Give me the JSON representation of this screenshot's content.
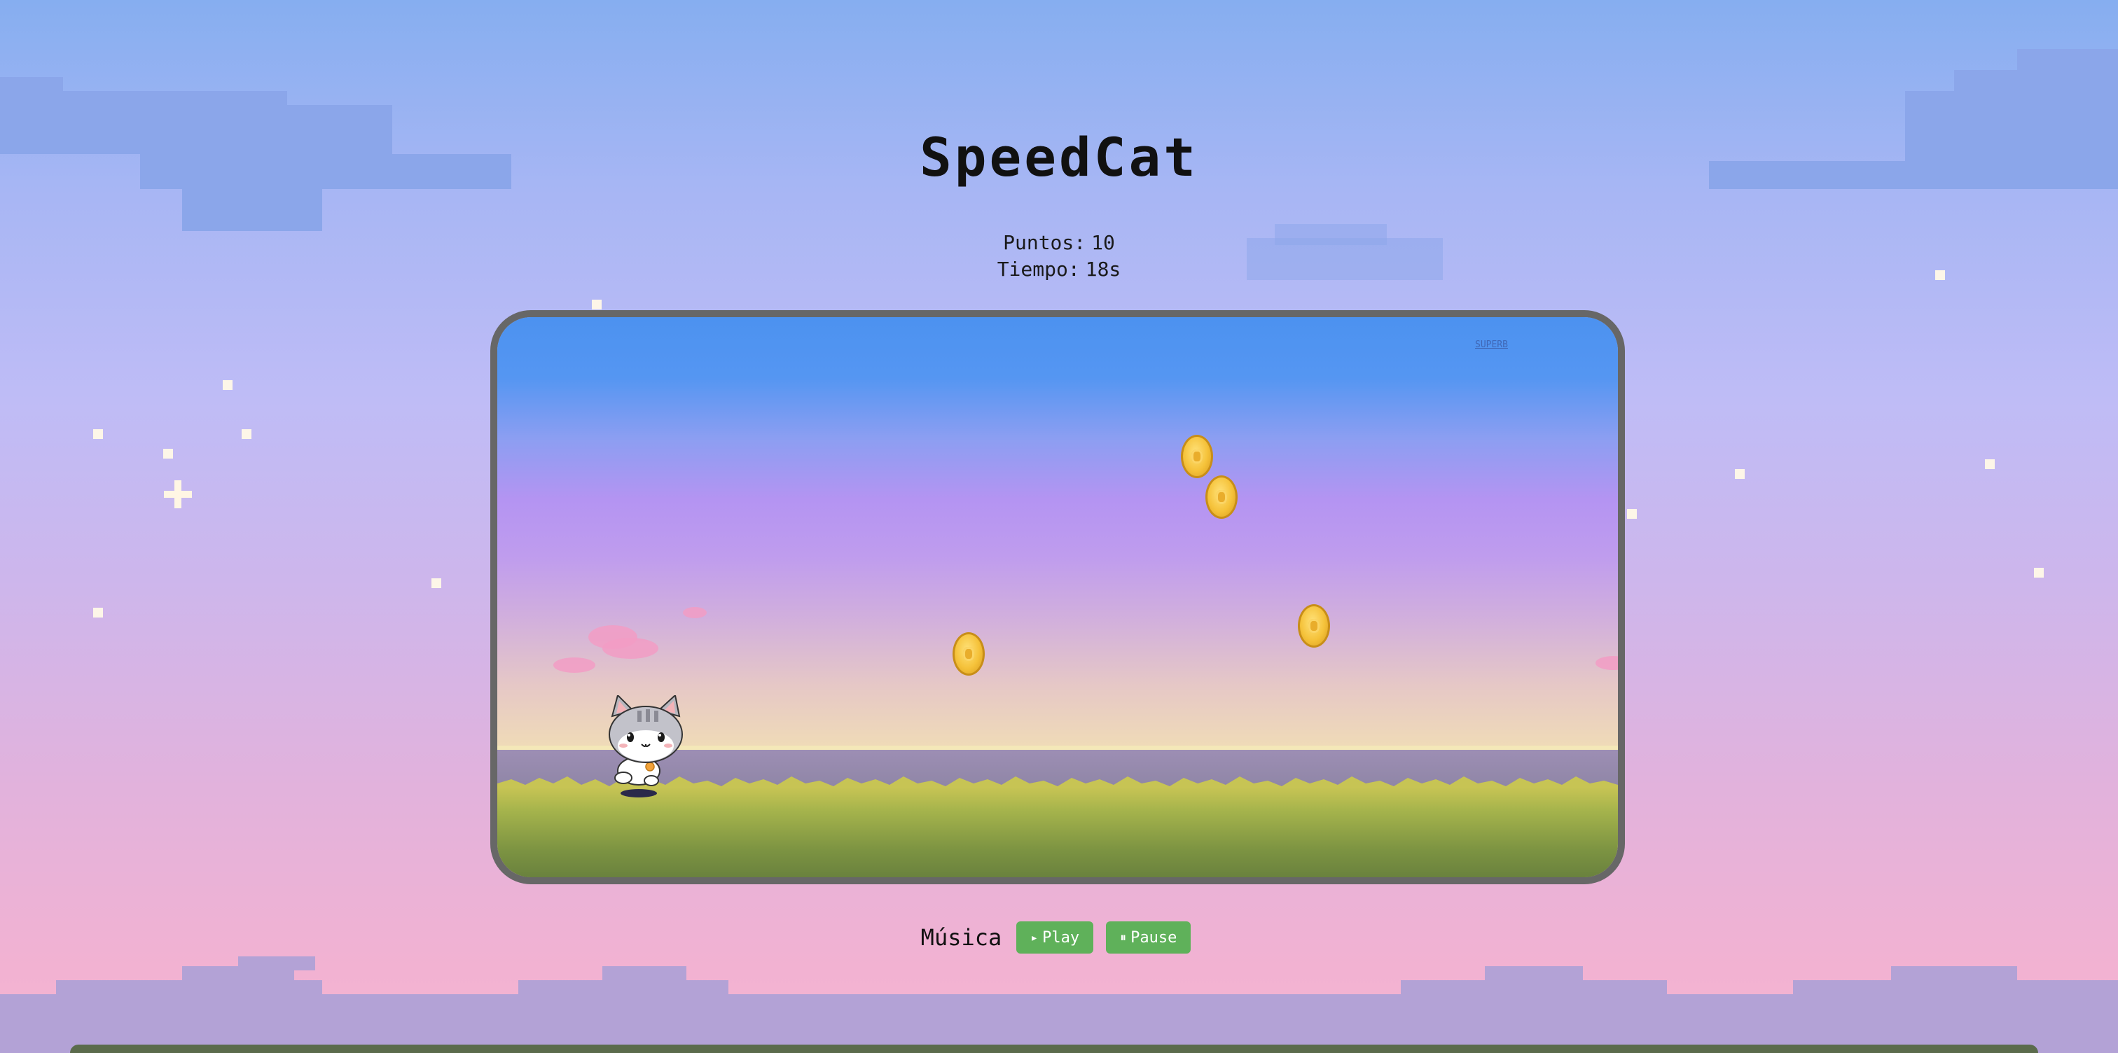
{
  "game": {
    "title": "SpeedCat",
    "score_label": "Puntos:",
    "score_value": "10",
    "time_label": "Tiempo:",
    "time_value": "18s",
    "canvas_tag": "SUPERB"
  },
  "music": {
    "label": "Música",
    "play_label": "Play",
    "pause_label": "Pause",
    "play_icon": "play-triangle-icon",
    "pause_icon": "pause-bars-icon"
  },
  "colors": {
    "button_bg": "#5fb15a",
    "frame_border": "#676767",
    "coin": "#f5c23a",
    "sky_top": "#4c92f0",
    "sky_mid": "#b494f2"
  },
  "scene": {
    "coins_visible": 4,
    "player": "cat"
  }
}
